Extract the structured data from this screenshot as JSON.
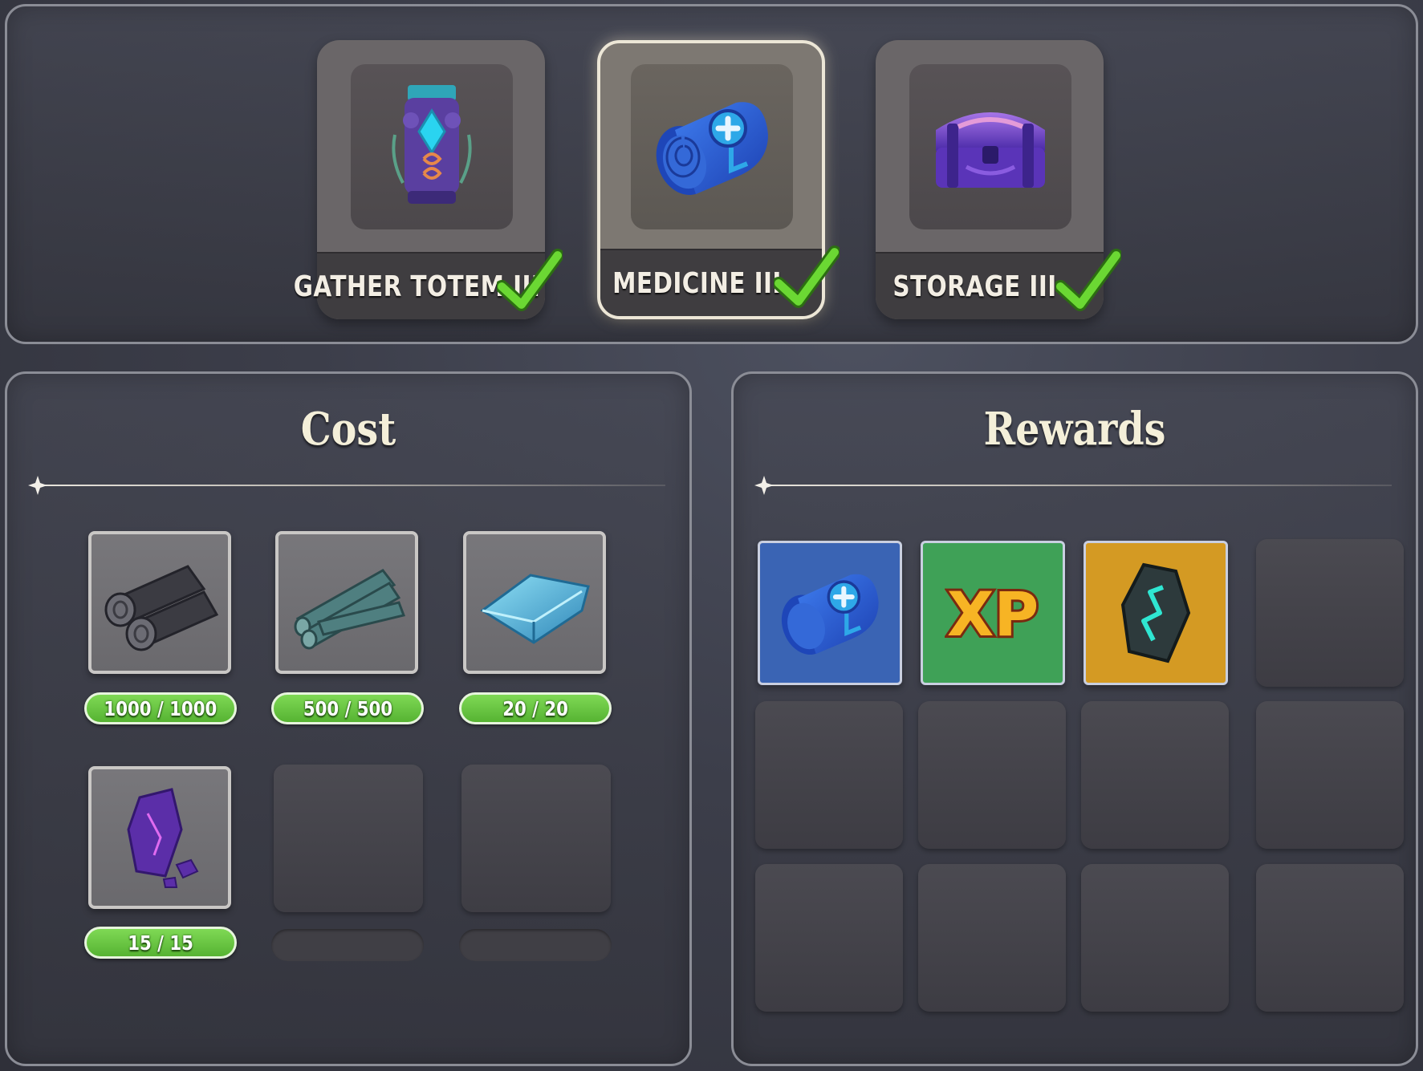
{
  "upgrades": [
    {
      "label": "GATHER TOTEM III",
      "icon": "totem-icon",
      "completed": true,
      "selected": false
    },
    {
      "label": "MEDICINE III",
      "icon": "bandage-roll-icon",
      "completed": true,
      "selected": true
    },
    {
      "label": "STORAGE III",
      "icon": "chest-icon",
      "completed": true,
      "selected": false
    }
  ],
  "cost": {
    "title": "Cost",
    "items": [
      {
        "icon": "dark-logs-icon",
        "amount": "1000 / 1000"
      },
      {
        "icon": "teal-logs-icon",
        "amount": "500 / 500"
      },
      {
        "icon": "crystal-ingot-icon",
        "amount": "20 / 20"
      },
      {
        "icon": "purple-crystal-icon",
        "amount": "15 / 15"
      }
    ]
  },
  "rewards": {
    "title": "Rewards",
    "items": [
      {
        "icon": "bandage-roll-icon",
        "background": "#3a64b4"
      },
      {
        "icon": "xp-icon",
        "text": "XP",
        "background": "#3fa157"
      },
      {
        "icon": "rune-stone-icon",
        "background": "#d49a23"
      }
    ]
  },
  "colors": {
    "check": "#5fcf2b",
    "pill_green": "#6cc845"
  }
}
